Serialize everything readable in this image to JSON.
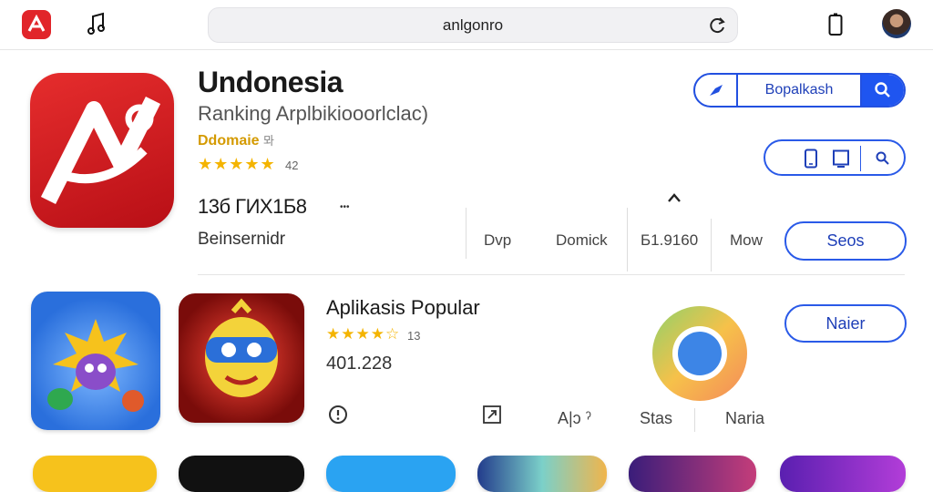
{
  "topbar": {
    "app_logo": "app-logo-icon",
    "music_icon": "music-note-icon",
    "address": "anlgonro",
    "reload_icon": "reload-icon",
    "phone_icon": "phone-icon",
    "avatar": "avatar"
  },
  "hero": {
    "title": "Undonesia",
    "subtitle": "Ranking Arplbikiooorlclac)",
    "developer": "Ddomaie",
    "developer_suffix": "뫄",
    "stars": "★★★★★",
    "stars_count": "42",
    "stat_value": "13б ГИХ1Б8",
    "stat_more": "•••",
    "stat_label": "Beinsernidr",
    "chevron": "^",
    "meta": [
      "Dvp",
      "Domick",
      "Б1.9160",
      "Mow"
    ],
    "see_button": "Seos"
  },
  "actions": {
    "share_icon": "share-icon",
    "search_label": "Bopalkash",
    "search_icon": "search-icon",
    "device_icon": "phone-outline-icon",
    "tablet_icon": "tablet-icon",
    "zoom_icon": "magnifier-icon"
  },
  "popular": {
    "title": "Aplikasis Popular",
    "stars": "★★★★☆",
    "stars_count": "13",
    "count": "401.228",
    "labels": [
      "A|ɔ ˀ",
      "Stas",
      "Naria"
    ],
    "next_button": "Naier"
  },
  "colors": {
    "accent": "#2250e0",
    "star": "#f4b400",
    "app_red": "#d91e24"
  }
}
